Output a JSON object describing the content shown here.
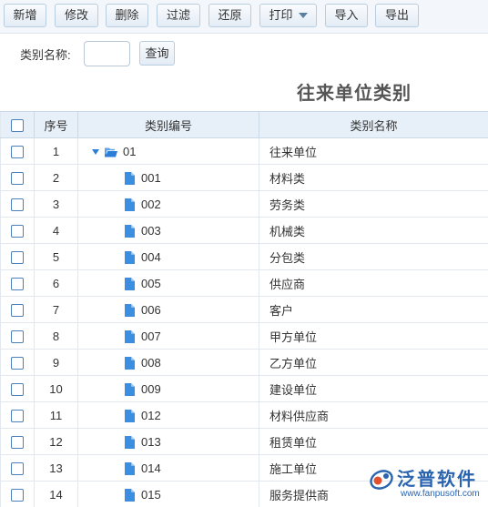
{
  "toolbar": {
    "buttons": [
      {
        "label": "新增"
      },
      {
        "label": "修改"
      },
      {
        "label": "删除"
      },
      {
        "label": "过滤"
      },
      {
        "label": "还原"
      },
      {
        "label": "打印"
      },
      {
        "label": "导入"
      },
      {
        "label": "导出"
      }
    ]
  },
  "search": {
    "label": "类别名称:",
    "value": "",
    "button_label": "查询"
  },
  "grid": {
    "title": "往来单位类别",
    "columns": [
      "序号",
      "类别编号",
      "类别名称"
    ],
    "rows": [
      {
        "index": "1",
        "code": "01",
        "name": "往来单位",
        "type": "folder"
      },
      {
        "index": "2",
        "code": "001",
        "name": "材料类",
        "type": "file"
      },
      {
        "index": "3",
        "code": "002",
        "name": "劳务类",
        "type": "file"
      },
      {
        "index": "4",
        "code": "003",
        "name": "机械类",
        "type": "file"
      },
      {
        "index": "5",
        "code": "004",
        "name": "分包类",
        "type": "file"
      },
      {
        "index": "6",
        "code": "005",
        "name": "供应商",
        "type": "file"
      },
      {
        "index": "7",
        "code": "006",
        "name": "客户",
        "type": "file"
      },
      {
        "index": "8",
        "code": "007",
        "name": "甲方单位",
        "type": "file"
      },
      {
        "index": "9",
        "code": "008",
        "name": "乙方单位",
        "type": "file"
      },
      {
        "index": "10",
        "code": "009",
        "name": "建设单位",
        "type": "file"
      },
      {
        "index": "11",
        "code": "012",
        "name": "材料供应商",
        "type": "file"
      },
      {
        "index": "12",
        "code": "013",
        "name": "租赁单位",
        "type": "file"
      },
      {
        "index": "13",
        "code": "014",
        "name": "施工单位",
        "type": "file"
      },
      {
        "index": "14",
        "code": "015",
        "name": "服务提供商",
        "type": "file"
      }
    ]
  },
  "watermark": {
    "name": "泛普软件",
    "url": "www.fanpusoft.com"
  },
  "colors": {
    "accent": "#2c7fd8",
    "header_bg": "#e7f0f9",
    "toolbar_bg": "#f3f6fa",
    "brand": "#2a64b0"
  }
}
